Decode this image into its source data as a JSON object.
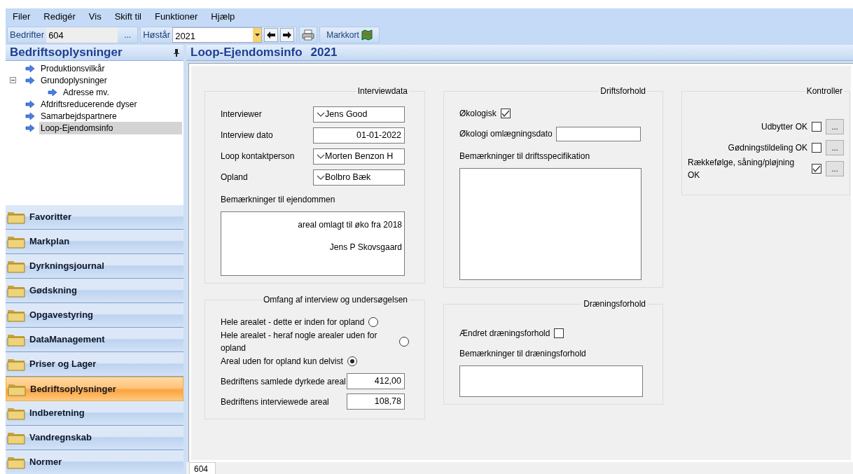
{
  "menu": [
    "Filer",
    "Redigér",
    "Vis",
    "Skift til",
    "Funktioner",
    "Hjælp"
  ],
  "toolbar": {
    "company_label": "Bedrifter",
    "company_value": "604",
    "browse_button": "...",
    "year_label": "Høstår",
    "year_value": "2021",
    "map_button": "Markkort"
  },
  "left_panel": {
    "title": "Bedriftsoplysninger",
    "tree": [
      {
        "label": "Produktionsvilkår",
        "selected": false
      },
      {
        "label": "Grundoplysninger",
        "selected": false,
        "expanded": true,
        "children": [
          {
            "label": "Adresse mv.",
            "selected": false
          }
        ]
      },
      {
        "label": "Afdriftsreducerende dyser",
        "selected": false
      },
      {
        "label": "Samarbejdspartnere",
        "selected": false
      },
      {
        "label": "Loop-Ejendomsinfo",
        "selected": true
      }
    ],
    "nav": [
      {
        "label": "Favoritter",
        "selected": false
      },
      {
        "label": "Markplan",
        "selected": false
      },
      {
        "label": "Dyrkningsjournal",
        "selected": false
      },
      {
        "label": "Gødskning",
        "selected": false
      },
      {
        "label": "Opgavestyring",
        "selected": false
      },
      {
        "label": "DataManagement",
        "selected": false
      },
      {
        "label": "Priser og Lager",
        "selected": false
      },
      {
        "label": "Bedriftsoplysninger",
        "selected": true
      },
      {
        "label": "Indberetning",
        "selected": false
      },
      {
        "label": "Vandregnskab",
        "selected": false
      },
      {
        "label": "Normer",
        "selected": false
      }
    ]
  },
  "main": {
    "title": "Loop-Ejendomsinfo",
    "year": "2021",
    "interview": {
      "legend": "Interviewdata",
      "fields": [
        {
          "label": "Interviewer",
          "kind": "dropdown",
          "value": "Jens Good"
        },
        {
          "label": "Interview dato",
          "kind": "text",
          "value": "01-01-2022"
        },
        {
          "label": "Loop kontaktperson",
          "kind": "dropdown",
          "value": "Morten Benzon H"
        },
        {
          "label": "Opland",
          "kind": "dropdown",
          "value": "Bolbro Bæk"
        }
      ],
      "notes_label": "Bemærkninger til ejendommen",
      "notes": [
        "areal omlagt til øko fra 2018",
        "Jens P Skovsgaard"
      ]
    },
    "scope": {
      "legend": "Omfang af interview og undersøgelsen",
      "options": [
        {
          "label": "Hele arealet - dette er inden for opland",
          "selected": false
        },
        {
          "label": "Hele arealet - heraf nogle arealer uden for opland",
          "selected": false
        },
        {
          "label": "Areal uden for opland kun delvist",
          "selected": true
        }
      ],
      "fields": [
        {
          "label": "Bedriftens samlede dyrkede areal",
          "value": "412,00"
        },
        {
          "label": "Bedriftens interviewede areal",
          "value": "108,78"
        }
      ]
    },
    "operation": {
      "legend": "Driftsforhold",
      "organic_label": "Økologisk",
      "organic_checked": true,
      "date_label": "Økologi omlægningsdato",
      "notes_label": "Bemærkninger til driftsspecifikation"
    },
    "drainage": {
      "legend": "Dræningsforhold",
      "changed_label": "Ændret dræningsforhold",
      "changed_checked": false,
      "notes_label": "Bemærkninger til dræningsforhold"
    },
    "controls": {
      "legend": "Kontroller",
      "items": [
        {
          "label": "Udbytter OK",
          "checked": false,
          "button": "..."
        },
        {
          "label": "Gødningstildeling OK",
          "checked": false,
          "button": "..."
        },
        {
          "label": "Rækkefølge, såning/pløjning OK",
          "checked": true,
          "button": "..."
        }
      ]
    }
  },
  "status_tab": "604"
}
